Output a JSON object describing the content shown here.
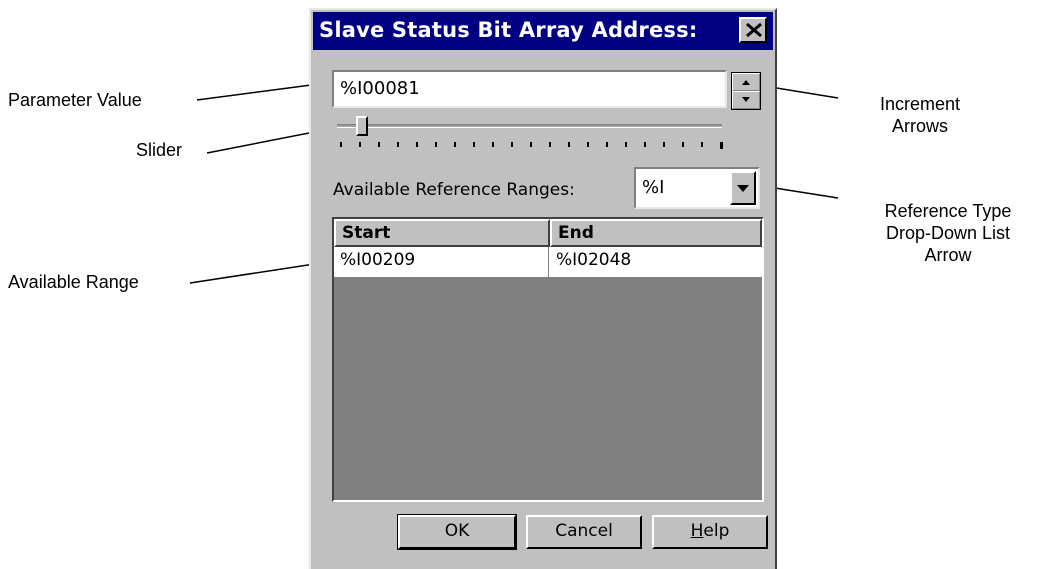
{
  "dialog": {
    "title": "Slave Status Bit Array Address:",
    "close_glyph": "✕",
    "parameter_value": "%I00081",
    "slider_position": 0.08,
    "slider_tick_count": 21,
    "ref_ranges_label": "Available Reference Ranges:",
    "ref_type_value": "%I",
    "table": {
      "columns": [
        "Start",
        "End"
      ],
      "rows": [
        {
          "start": "%I00209",
          "end": "%I02048"
        }
      ]
    },
    "buttons": {
      "ok": "OK",
      "cancel": "Cancel",
      "help": "Help"
    }
  },
  "callouts": {
    "parameter_value": "Parameter Value",
    "slider": "Slider",
    "available_range": "Available Range",
    "increment_arrows_1": "Increment",
    "increment_arrows_2": "Arrows",
    "ref_type_1": "Reference Type",
    "ref_type_2": "Drop-Down List",
    "ref_type_3": "Arrow"
  },
  "colors": {
    "title_bar": "#000080",
    "dialog_face": "#c0c0c0",
    "table_empty": "#808080"
  }
}
